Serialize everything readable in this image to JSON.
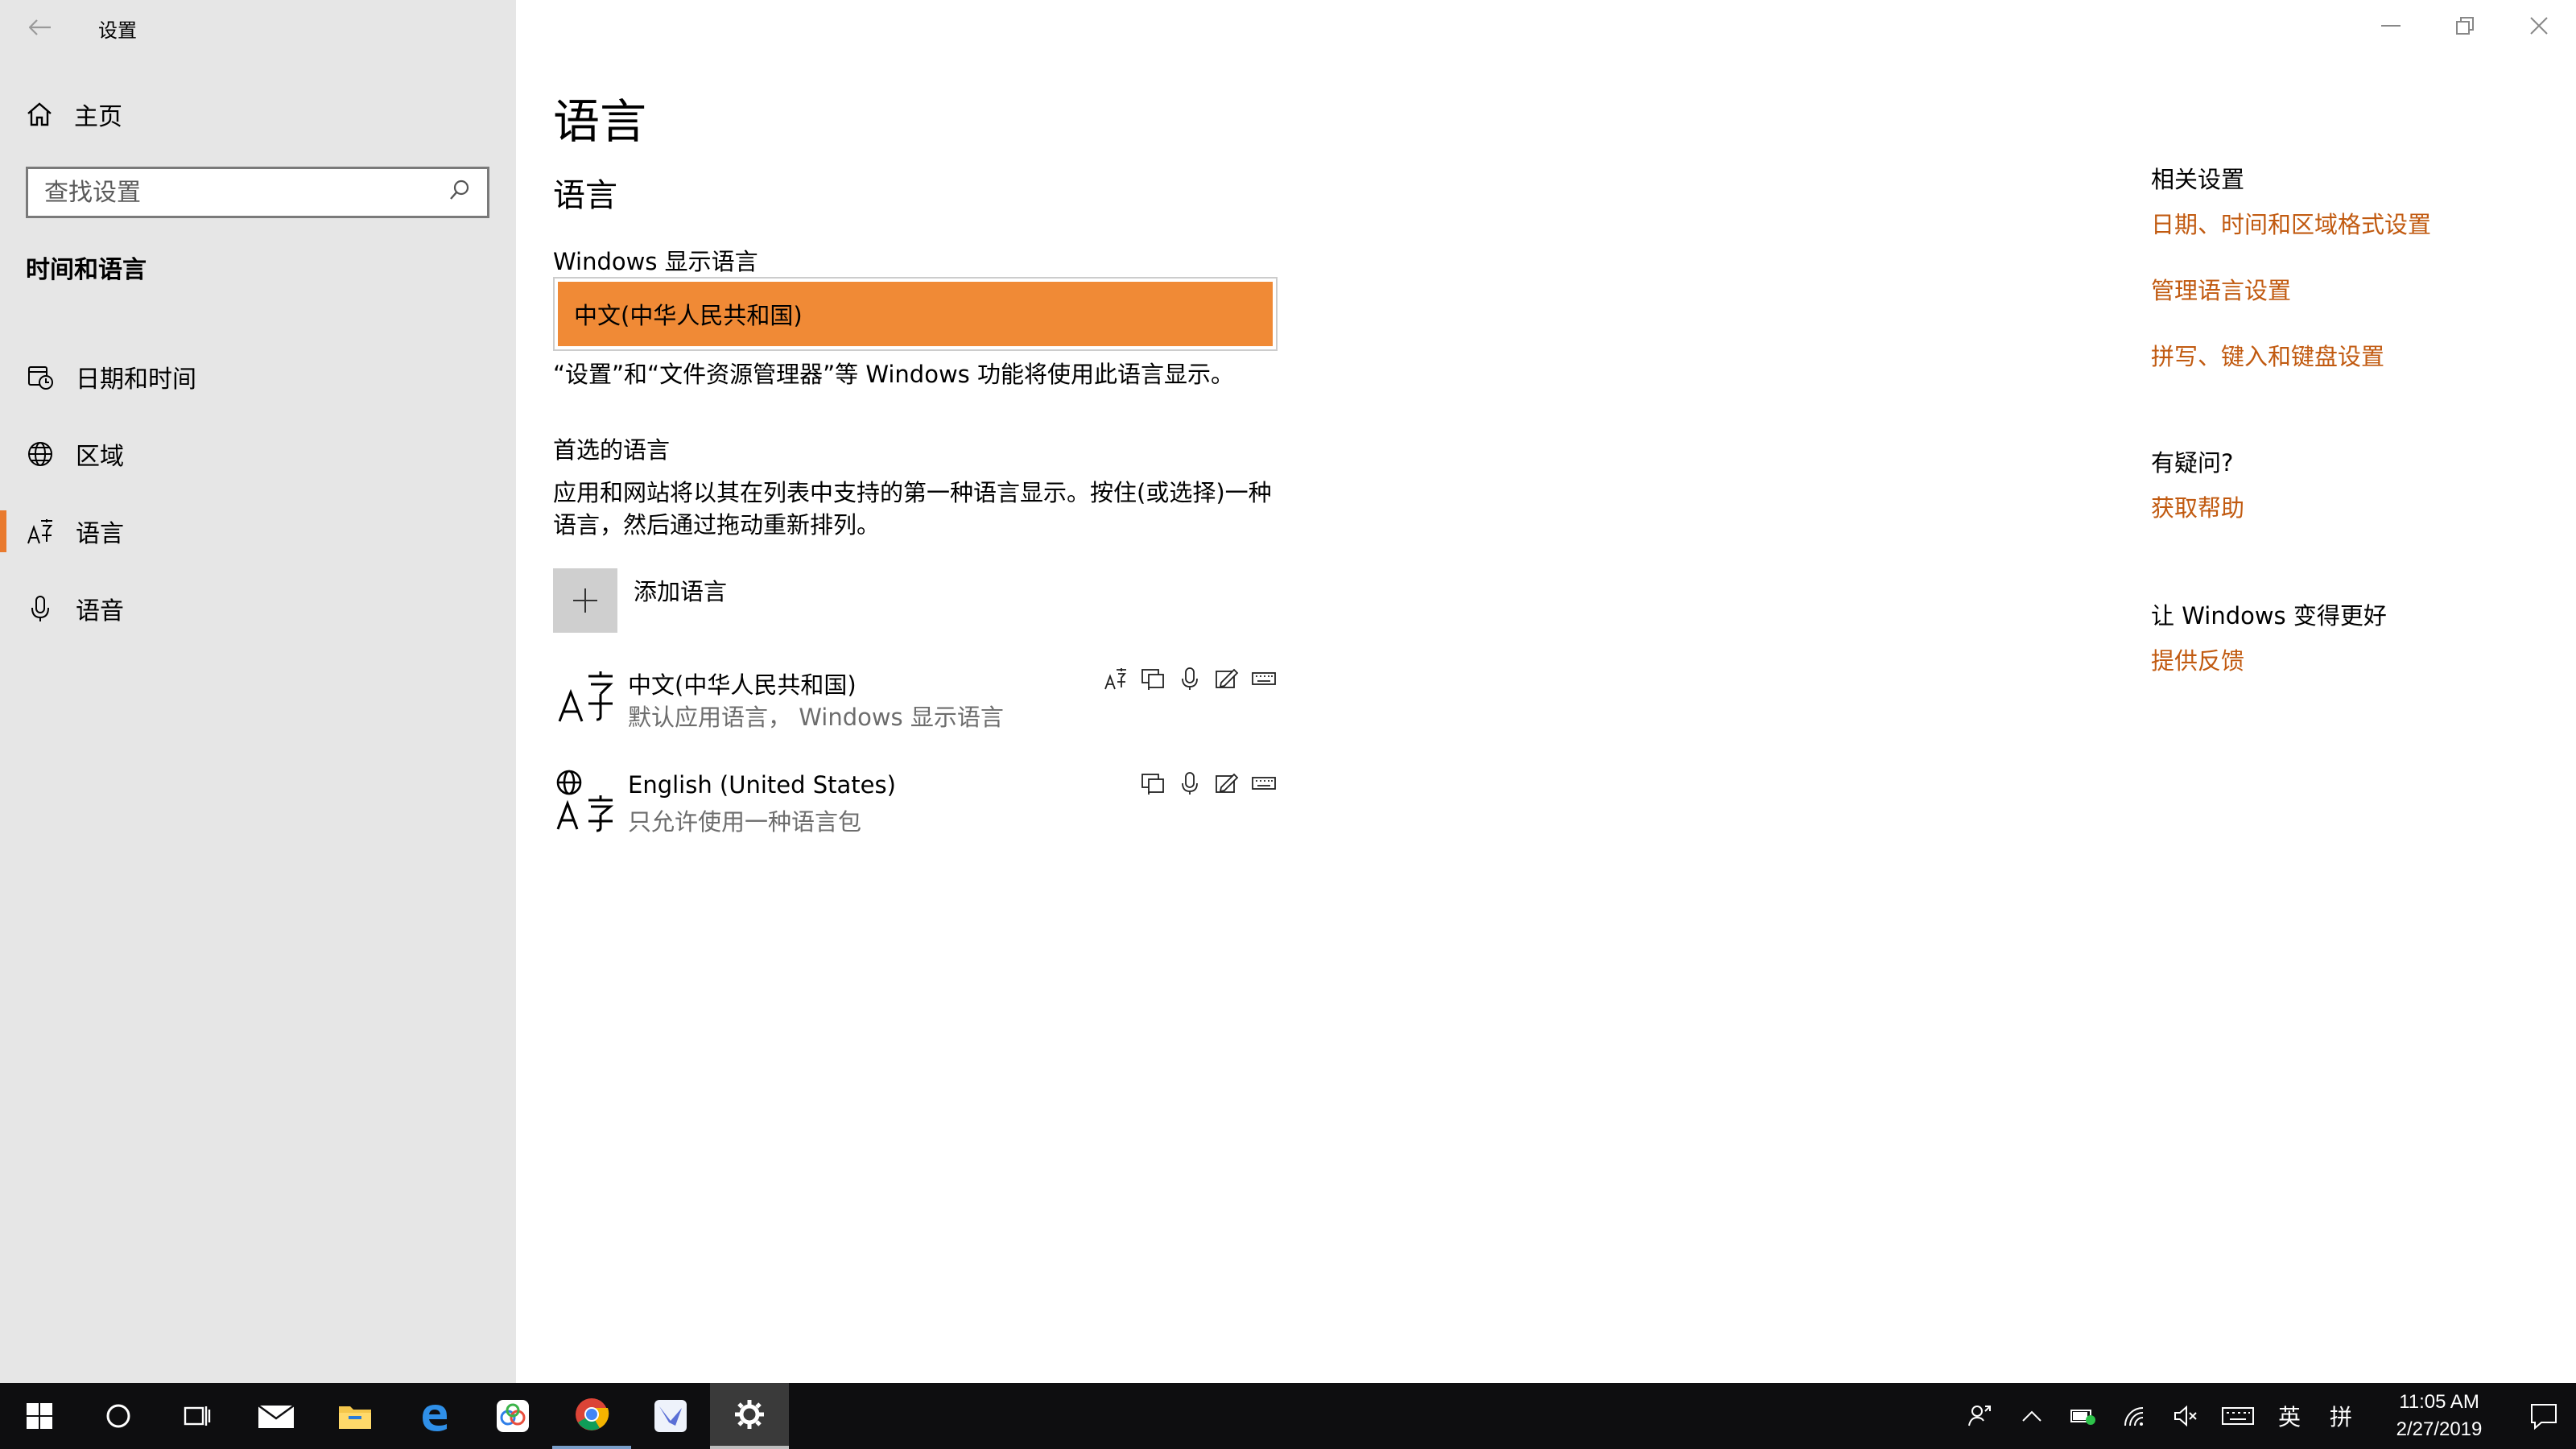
{
  "window": {
    "app_title": "设置",
    "controls": {
      "minimize": "—",
      "restore": "❐",
      "close": "✕"
    }
  },
  "sidebar": {
    "home_label": "主页",
    "search_placeholder": "查找设置",
    "section_header": "时间和语言",
    "items": [
      {
        "label": "日期和时间",
        "icon": "date-time-icon",
        "active": false
      },
      {
        "label": "区域",
        "icon": "globe-icon",
        "active": false
      },
      {
        "label": "语言",
        "icon": "language-icon",
        "active": true
      },
      {
        "label": "语音",
        "icon": "microphone-icon",
        "active": false
      }
    ],
    "accent_color": "#e97a2e"
  },
  "main": {
    "page_title": "语言",
    "sub_title": "语言",
    "display_language": {
      "label": "Windows 显示语言",
      "selected": "中文(中华人民共和国)",
      "note": "“设置”和“文件资源管理器”等 Windows 功能将使用此语言显示。"
    },
    "preferred": {
      "title": "首选的语言",
      "description": "应用和网站将以其在列表中支持的第一种语言显示。按住(或选择)一种语言，然后通过拖动重新排列。",
      "add_label": "添加语言",
      "languages": [
        {
          "name": "中文(中华人民共和国)",
          "sub": "默认应用语言， Windows 显示语言"
        },
        {
          "name": "English (United States)",
          "sub": "只允许使用一种语言包"
        }
      ]
    }
  },
  "related": {
    "heading": "相关设置",
    "links": [
      "日期、时间和区域格式设置",
      "管理语言设置",
      "拼写、键入和键盘设置"
    ],
    "help_heading": "有疑问?",
    "help_link": "获取帮助",
    "feedback_heading": "让 Windows 变得更好",
    "feedback_link": "提供反馈",
    "link_color": "#c15a10"
  },
  "taskbar": {
    "ime_lang": "英",
    "ime_mode": "拼",
    "time": "11:05 AM",
    "date": "2/27/2019"
  }
}
